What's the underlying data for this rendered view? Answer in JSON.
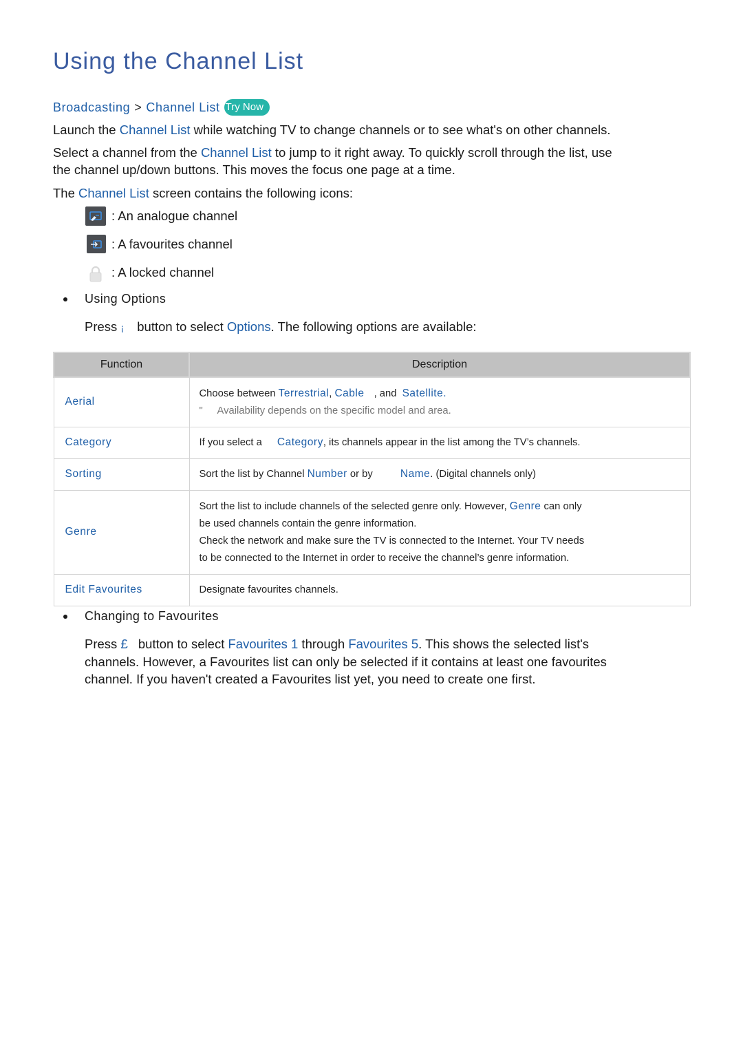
{
  "title": "Using the Channel List",
  "breadcrumb": {
    "items": [
      "Broadcasting",
      "Channel List"
    ],
    "separator": ">",
    "try_now": "Try Now"
  },
  "intro": {
    "p1": {
      "before": "Launch the ",
      "link": "Channel List",
      "after": " while watching TV to change channels or to see what's on other channels."
    },
    "p2": {
      "before": "Select a channel from the ",
      "link": "Channel List",
      "after_line1": " to jump to it right away. To quickly scroll through the list, use",
      "line2": "the channel up/down buttons. This moves the focus one page at a time."
    },
    "p3": {
      "before": "The ",
      "link": "Channel List",
      "after": " screen contains the following icons:"
    }
  },
  "icons": [
    {
      "icon": "analogue-channel-icon",
      "text": ": An analogue channel"
    },
    {
      "icon": "favourites-channel-icon",
      "text": ": A favourites channel"
    },
    {
      "icon": "lock-icon",
      "text": ": A locked channel"
    }
  ],
  "using_options": {
    "heading": "Using Options",
    "press": "Press ",
    "button_glyph": "¡",
    "mid": " button to select ",
    "link": "Options",
    "after": ". The following options are available:"
  },
  "table": {
    "headers": [
      "Function",
      "Description"
    ],
    "rows": [
      {
        "function": "Aerial",
        "desc": {
          "prefix": "Choose between ",
          "opt1": "Terrestrial",
          "comma": ", ",
          "opt2": "Cable",
          "and": " , and ",
          "opt3": "Satellite",
          "end": ".",
          "note_mark": "\"",
          "note": "Availability depends on the specific model and area."
        }
      },
      {
        "function": "Category",
        "desc": {
          "prefix": "If you select a ",
          "link": "Category",
          "suffix": ", its channels appear in the list among the TV’s channels."
        }
      },
      {
        "function": "Sorting",
        "desc": {
          "prefix": "Sort the list by Channel ",
          "link1": "Number",
          "mid": " or by ",
          "link2": "Name",
          "suffix": ". (Digital channels only)"
        }
      },
      {
        "function": "Genre",
        "desc": {
          "line1_prefix": "Sort the list to include channels of the selected genre only. However, ",
          "link": "Genre",
          "line1_suffix": " can only",
          "line2": "be used channels contain the genre information.",
          "line3": "Check the network and make sure the TV is connected to the Internet. Your TV needs",
          "line4": "to be connected to the Internet in order to receive the channel’s genre information."
        }
      },
      {
        "function": "Edit Favourites",
        "desc": {
          "text": "Designate favourites channels."
        }
      }
    ]
  },
  "changing_favourites": {
    "heading": "Changing to Favourites",
    "press": "Press ",
    "button_glyph": "£",
    "mid": " button to select ",
    "link1": "Favourites 1",
    "through": " through ",
    "link2": "Favourites 5",
    "after_line1": ". This shows the selected list's",
    "line2": "channels. However, a Favourites list can only be selected if it contains at least one favourites",
    "line3": "channel. If you haven't created a Favourites list yet, you need to create one first."
  },
  "colors": {
    "title": "#3a5ba0",
    "link": "#1f5fa8",
    "try_now_bg": "#26b5a9",
    "table_header_bg": "#c1c1c1",
    "icon_bg": "#4a4d52",
    "icon_accent": "#3b8fe6"
  }
}
